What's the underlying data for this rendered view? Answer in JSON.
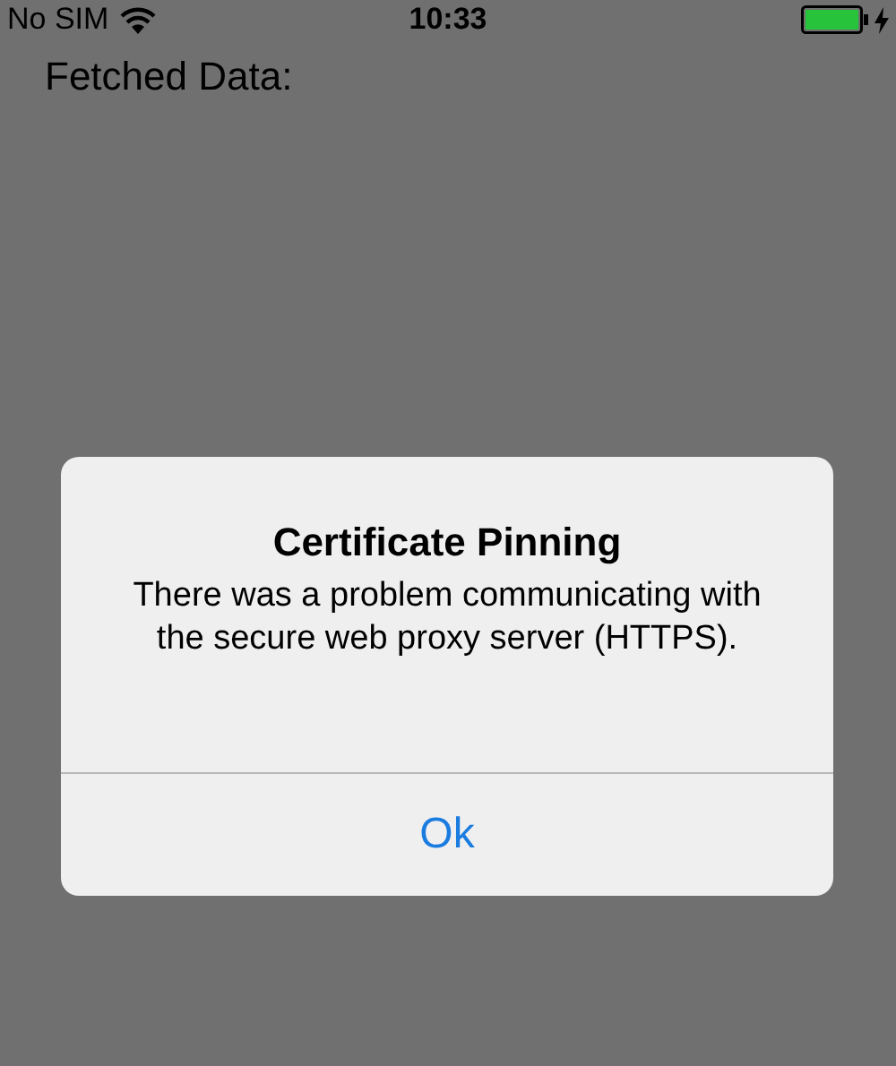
{
  "status_bar": {
    "carrier": "No SIM",
    "time": "10:33"
  },
  "screen": {
    "heading": "Fetched Data:"
  },
  "alert": {
    "title": "Certificate Pinning",
    "message": "There was a problem communicating with the secure web proxy server (HTTPS).",
    "buttons": [
      "Ok"
    ]
  }
}
